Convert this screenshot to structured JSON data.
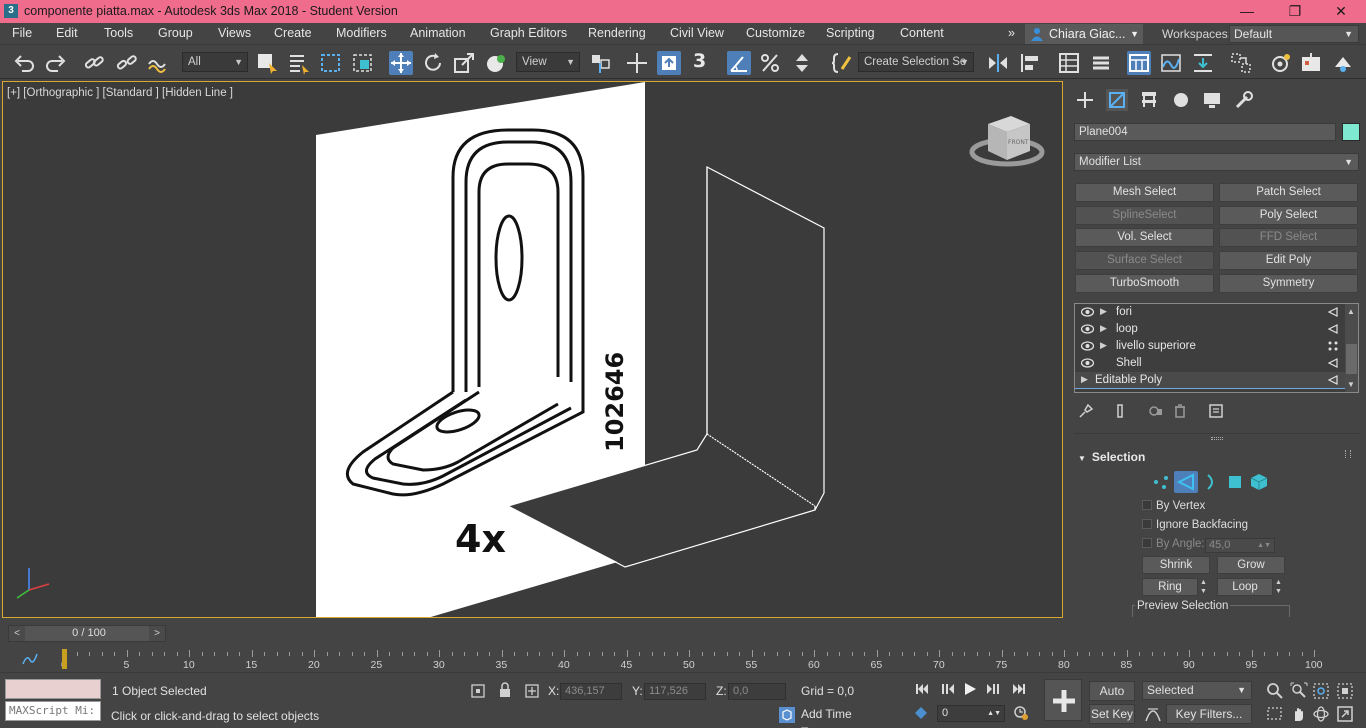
{
  "window": {
    "app_icon": "3",
    "title": "componente piatta.max - Autodesk 3ds Max 2018 - Student Version",
    "minimize": "—",
    "maximize": "❐",
    "close": "✕"
  },
  "menu": {
    "items": [
      "File",
      "Edit",
      "Tools",
      "Group",
      "Views",
      "Create",
      "Modifiers",
      "Animation",
      "Graph Editors",
      "Rendering",
      "Civil View",
      "Customize",
      "Scripting",
      "Content"
    ],
    "overflow": "»",
    "user": "Chiara Giac...",
    "workspaces_label": "Workspaces:",
    "workspace_value": "Default"
  },
  "toolbar": {
    "filter_value": "All",
    "ref_coord_value": "View",
    "selection_set_value": "Create Selection Se",
    "snap_value": "3"
  },
  "viewport": {
    "label": "[+] [Orthographic ] [Standard ] [Hidden Line ]",
    "image_code": "102646",
    "image_qty": "4x",
    "viewcube_face": "FRONT"
  },
  "command_panel": {
    "object_name": "Plane004",
    "object_color": "#7ee8d0",
    "modifier_list": "Modifier List",
    "modifier_buttons": [
      {
        "label": "Mesh Select",
        "enabled": true
      },
      {
        "label": "Patch Select",
        "enabled": true
      },
      {
        "label": "SplineSelect",
        "enabled": false
      },
      {
        "label": "Poly Select",
        "enabled": true
      },
      {
        "label": "Vol. Select",
        "enabled": true
      },
      {
        "label": "FFD Select",
        "enabled": false
      },
      {
        "label": "Surface Select",
        "enabled": false
      },
      {
        "label": "Edit Poly",
        "enabled": true
      },
      {
        "label": "TurboSmooth",
        "enabled": true
      },
      {
        "label": "Symmetry",
        "enabled": true
      }
    ],
    "stack": [
      {
        "label": "fori",
        "expandable": true,
        "visible": true,
        "indicator": "triangle"
      },
      {
        "label": "loop",
        "expandable": true,
        "visible": true,
        "indicator": "triangle"
      },
      {
        "label": "livello superiore",
        "expandable": true,
        "visible": true,
        "indicator": "vertex"
      },
      {
        "label": "Shell",
        "expandable": false,
        "visible": true,
        "indicator": "triangle"
      },
      {
        "label": "Editable Poly",
        "expandable": true,
        "visible": false,
        "indicator": "triangle"
      }
    ],
    "selection": {
      "header": "Selection",
      "by_vertex": "By Vertex",
      "ignore_backfacing": "Ignore Backfacing",
      "by_angle": "By Angle:",
      "angle_value": "45,0",
      "shrink": "Shrink",
      "grow": "Grow",
      "ring": "Ring",
      "loop": "Loop",
      "preview_selection": "Preview Selection"
    }
  },
  "timeline": {
    "frame_label": "0 / 100",
    "prev": "<",
    "next": ">",
    "ticks": [
      "0",
      "5",
      "10",
      "15",
      "20",
      "25",
      "30",
      "35",
      "40",
      "45",
      "50",
      "55",
      "60",
      "65",
      "70",
      "75",
      "80",
      "85",
      "90",
      "95",
      "100"
    ]
  },
  "status": {
    "maxscript_placeholder": "MAXScript Mi:",
    "objects_selected": "1 Object Selected",
    "prompt": "Click or click-and-drag to select objects",
    "x_label": "X:",
    "x_value": "436,157",
    "y_label": "Y:",
    "y_value": "117,526",
    "z_label": "Z:",
    "z_value": "0,0",
    "grid": "Grid = 0,0",
    "add_time_tag": "Add Time Tag",
    "auto_key": "Auto Key",
    "set_key": "Set Key",
    "selected_value": "Selected",
    "key_filters": "Key Filters...",
    "current_frame": "0"
  }
}
